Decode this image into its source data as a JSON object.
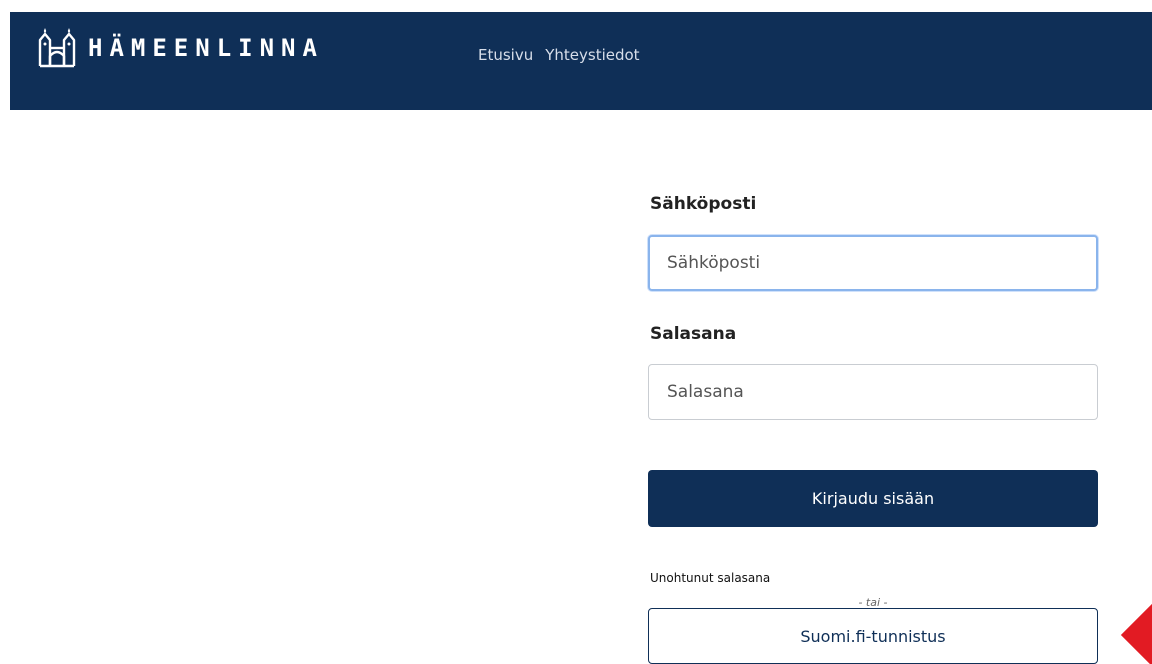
{
  "header": {
    "logo_text": "HÄMEENLINNA",
    "logo_icon": "castle-icon",
    "nav": [
      {
        "label": "Etusivu"
      },
      {
        "label": "Yhteystiedot"
      }
    ],
    "background": "#0f2f57"
  },
  "form": {
    "email": {
      "label": "Sähköposti",
      "placeholder": "Sähköposti",
      "value": ""
    },
    "password": {
      "label": "Salasana",
      "placeholder": "Salasana",
      "value": ""
    },
    "login_label": "Kirjaudu sisään",
    "forgot_label": "Unohtunut salasana",
    "or_label": "- tai -",
    "suomi_label": "Suomi.fi-tunnistus"
  },
  "marker_color": "#e21b23"
}
